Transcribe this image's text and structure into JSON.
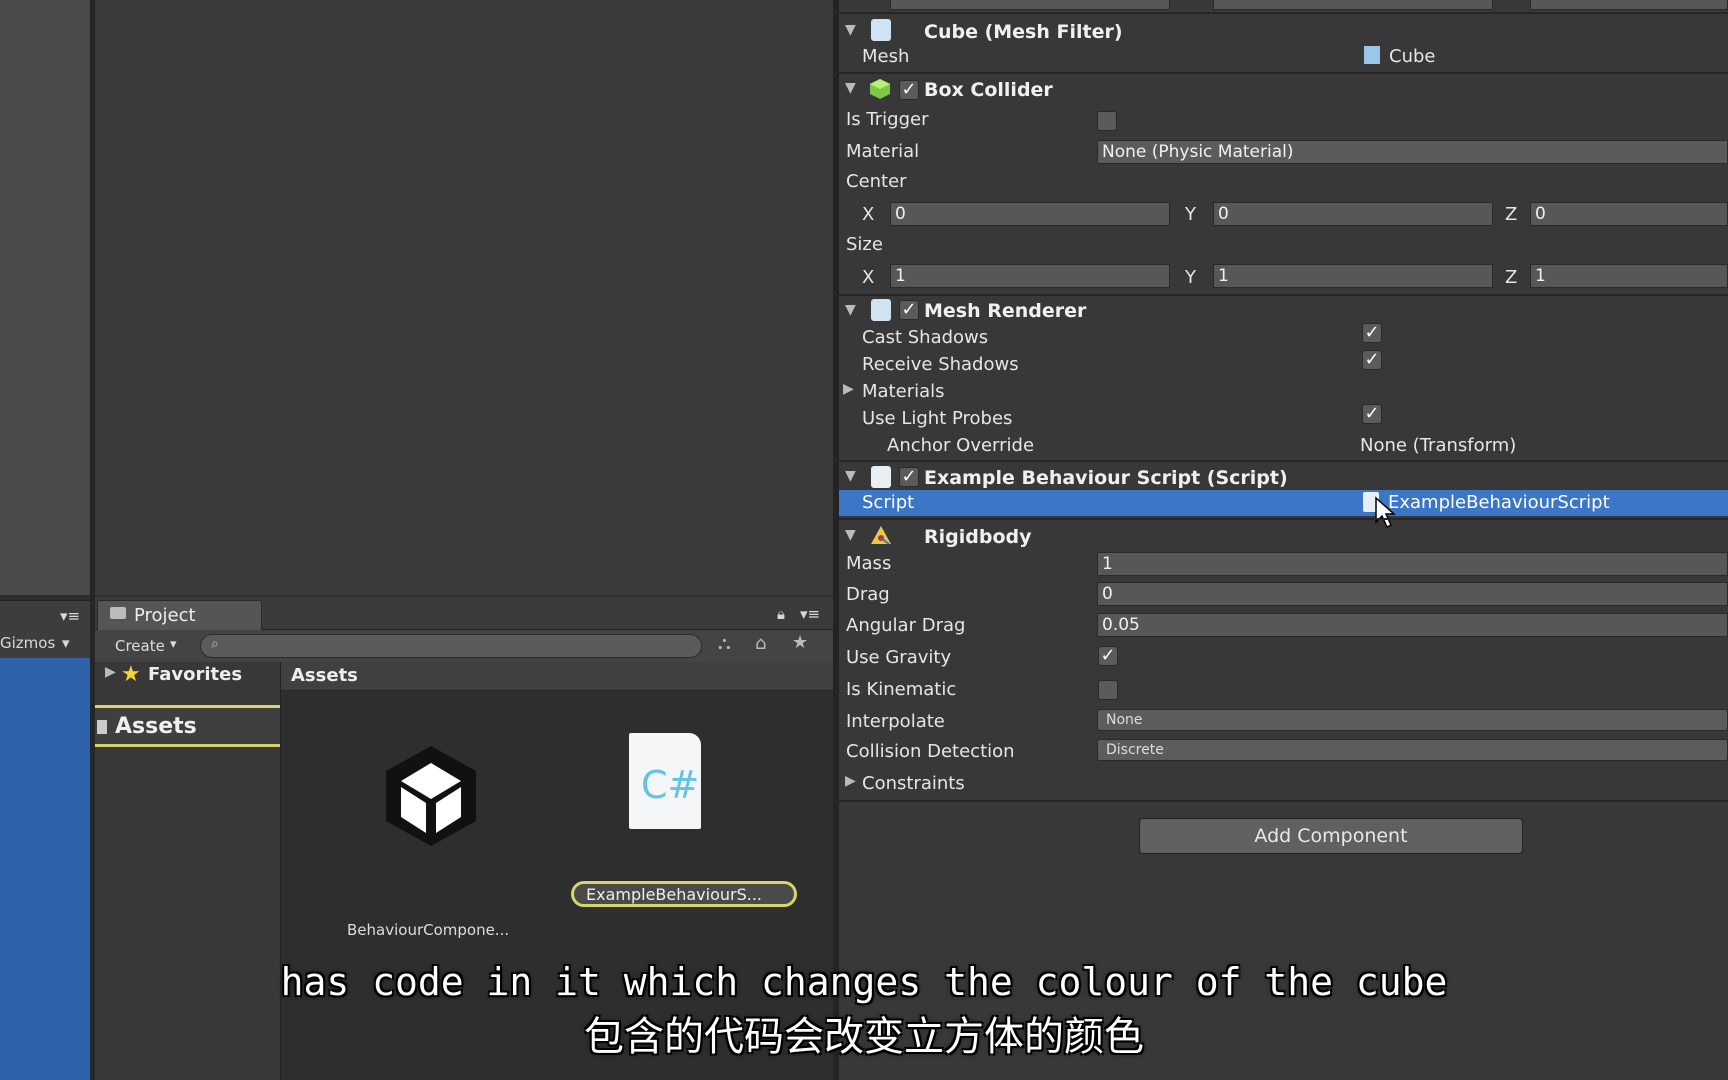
{
  "hierarchy": {
    "gizmos_label": "Gizmos"
  },
  "project": {
    "tab_label": "Project",
    "create_label": "Create",
    "favorites_label": "Favorites",
    "assets_sidebar_label": "Assets",
    "assets_header": "Assets",
    "items": [
      {
        "name": "BehaviourCompone...",
        "icon": "unity-logo-icon"
      },
      {
        "name": "ExampleBehaviourS...",
        "icon": "csharp-file-icon"
      }
    ]
  },
  "inspector": {
    "mesh_filter": {
      "title": "Cube (Mesh Filter)",
      "mesh_label": "Mesh",
      "mesh_value": "Cube"
    },
    "box_collider": {
      "title": "Box Collider",
      "is_trigger_label": "Is Trigger",
      "is_trigger": false,
      "material_label": "Material",
      "material_value": "None (Physic Material)",
      "center_label": "Center",
      "center": {
        "x": "0",
        "y": "0",
        "z": "0"
      },
      "size_label": "Size",
      "size": {
        "x": "1",
        "y": "1",
        "z": "1"
      },
      "x_label": "X",
      "y_label": "Y",
      "z_label": "Z"
    },
    "mesh_renderer": {
      "title": "Mesh Renderer",
      "cast_shadows_label": "Cast Shadows",
      "cast_shadows": true,
      "receive_shadows_label": "Receive Shadows",
      "receive_shadows": true,
      "materials_label": "Materials",
      "use_light_probes_label": "Use Light Probes",
      "use_light_probes": true,
      "anchor_override_label": "Anchor Override",
      "anchor_override_value": "None (Transform)"
    },
    "script_component": {
      "title": "Example Behaviour Script (Script)",
      "script_label": "Script",
      "script_value": "ExampleBehaviourScript"
    },
    "rigidbody": {
      "title": "Rigidbody",
      "mass_label": "Mass",
      "mass": "1",
      "drag_label": "Drag",
      "drag": "0",
      "angular_drag_label": "Angular Drag",
      "angular_drag": "0.05",
      "use_gravity_label": "Use Gravity",
      "use_gravity": true,
      "is_kinematic_label": "Is Kinematic",
      "is_kinematic": false,
      "interpolate_label": "Interpolate",
      "interpolate_value": "None",
      "collision_detection_label": "Collision Detection",
      "collision_detection_value": "Discrete",
      "constraints_label": "Constraints"
    },
    "add_component_label": "Add Component"
  },
  "subtitles": {
    "english": "has code in it which changes the colour of the cube",
    "chinese": "包含的代码会改变立方体的颜色"
  },
  "colors": {
    "selection_blue": "#3b76c7",
    "highlight_yellow": "#d6d46a",
    "panel_dark": "#383838"
  }
}
